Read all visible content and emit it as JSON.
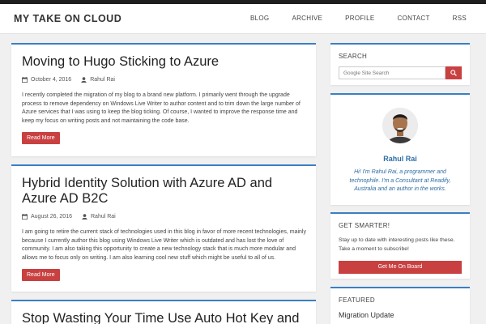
{
  "brand": "MY TAKE ON CLOUD",
  "nav": [
    "BLOG",
    "ARCHIVE",
    "PROFILE",
    "CONTACT",
    "RSS"
  ],
  "posts": [
    {
      "title": "Moving to Hugo Sticking to Azure",
      "date": "October 4, 2016",
      "author": "Rahul Rai",
      "excerpt": "I recently completed the migration of my blog to a brand new platform. I primarily went through the upgrade process to remove dependency on Windows Live Writer to author content and to trim down the large number of Azure services that I was using to keep the blog ticking. Of course, I wanted to improve the response time and keep my focus on writing posts and not maintaining the code base.",
      "button": "Read More"
    },
    {
      "title": "Hybrid Identity Solution with Azure AD and Azure AD B2C",
      "date": "August 26, 2016",
      "author": "Rahul Rai",
      "excerpt": "I am going to retire the current stack of technologies used in this blog in favor of more recent technologies, mainly because I currently author this blog using Windows Live Writer which is outdated and has lost the love of community. I am also taking this opportunity to create a new technology stack that is much more modular and allows me to focus only on writing. I am also learning cool new stuff which might be useful to all of us.",
      "button": "Read More"
    },
    {
      "title": "Stop Wasting Your Time Use Auto Hot Key and"
    }
  ],
  "sidebar": {
    "search": {
      "heading": "SEARCH",
      "placeholder": "Google Site Search"
    },
    "author": {
      "name": "Rahul Rai",
      "bio": "Hi! I'm Rahul Rai, a programmer and technophile. I'm a Consultant at Readify, Australia and an author in the works."
    },
    "subscribe": {
      "heading": "GET SMARTER!",
      "text": "Stay up to date with interesting posts like these. Take a moment to subscribe!",
      "button": "Get Me On Board"
    },
    "featured": {
      "heading": "FEATURED",
      "item": "Migration Update"
    }
  },
  "colors": {
    "accent": "#3a7fc4",
    "button": "#c94040",
    "link": "#2e6da4"
  }
}
